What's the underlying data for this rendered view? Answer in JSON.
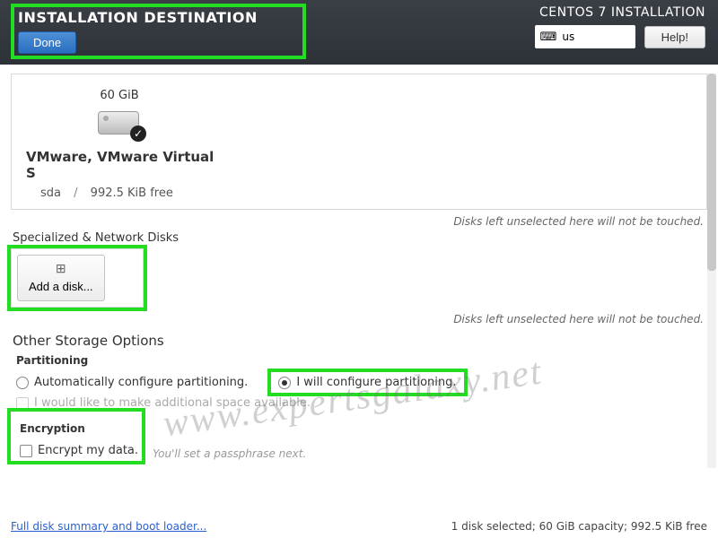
{
  "header": {
    "page_title": "INSTALLATION DESTINATION",
    "done_label": "Done",
    "installer_title": "CENTOS 7 INSTALLATION",
    "keyboard_layout": "us",
    "help_label": "Help!"
  },
  "disks": {
    "local_disk": {
      "capacity": "60 GiB",
      "name": "VMware, VMware Virtual S",
      "device": "sda",
      "free": "992.5 KiB free"
    },
    "hint": "Disks left unselected here will not be touched."
  },
  "specialized": {
    "section_label": "Specialized & Network Disks",
    "add_disk_label": "Add a disk...",
    "hint": "Disks left unselected here will not be touched."
  },
  "storage": {
    "section_header": "Other Storage Options",
    "partitioning_label": "Partitioning",
    "auto_label": "Automatically configure partitioning.",
    "manual_label": "I will configure partitioning.",
    "reclaim_label": "I would like to make additional space available.",
    "encryption_label": "Encryption",
    "encrypt_label": "Encrypt my data.",
    "encrypt_hint": "You'll set a passphrase next."
  },
  "footer": {
    "link_label": "Full disk summary and boot loader...",
    "status": "1 disk selected; 60 GiB capacity; 992.5 KiB free"
  },
  "watermark": "www.expertsgalaxy.net"
}
